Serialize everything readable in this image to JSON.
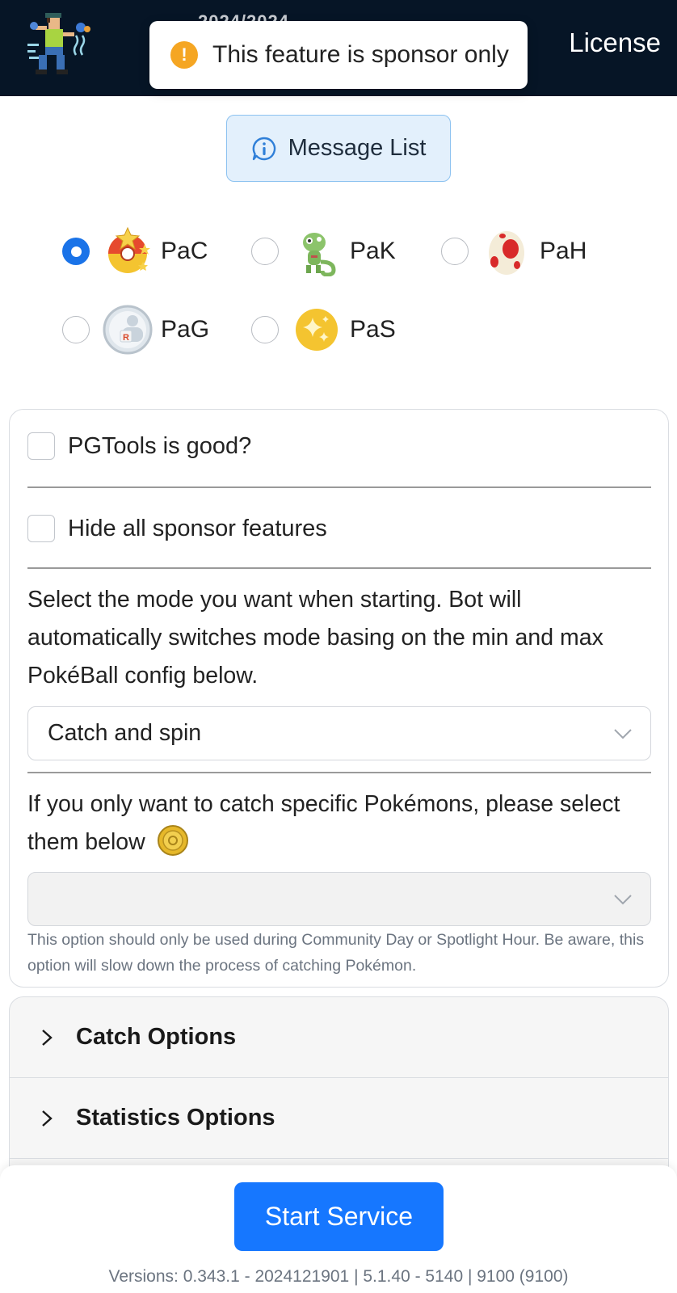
{
  "header": {
    "ghost_text": "2024/2024",
    "license_label": "License"
  },
  "toast": {
    "message": "This feature is sponsor only",
    "icon": "warning-icon",
    "color": "#f5a623"
  },
  "message_button": {
    "label": "Message List",
    "icon": "chat-bubble-icon"
  },
  "radio_options": [
    {
      "label": "PaC",
      "icon": "catch-ball-icon",
      "selected": true
    },
    {
      "label": "PaK",
      "icon": "kecleon-icon",
      "selected": false
    },
    {
      "label": "PaH",
      "icon": "egg-icon",
      "selected": false
    },
    {
      "label": "PaG",
      "icon": "rocket-grunt-icon",
      "selected": false
    },
    {
      "label": "PaS",
      "icon": "sparkle-icon",
      "selected": false
    }
  ],
  "settings": {
    "good_label": "PGTools is good?",
    "hide_sponsor_label": "Hide all sponsor features",
    "mode_description": "Select the mode you want when starting. Bot will automatically switches mode basing on the min and max PokéBall config below.",
    "mode_selected": "Catch and spin",
    "specific_description": "If you only want to catch specific Pokémons, please select them below",
    "specific_selected": "",
    "help_text": "This option should only be used during Community Day or Spotlight Hour. Be aware, this option will slow down the process of catching Pokémon."
  },
  "accordion": {
    "items": [
      "Catch Options",
      "Statistics Options"
    ]
  },
  "footer": {
    "start_label": "Start Service",
    "versions": "Versions: 0.343.1 - 2024121901 | 5.1.40 - 5140 | 9100 (9100)"
  },
  "colors": {
    "header_bg": "#061526",
    "primary": "#1677ff",
    "radio_checked": "#1a73e8"
  }
}
